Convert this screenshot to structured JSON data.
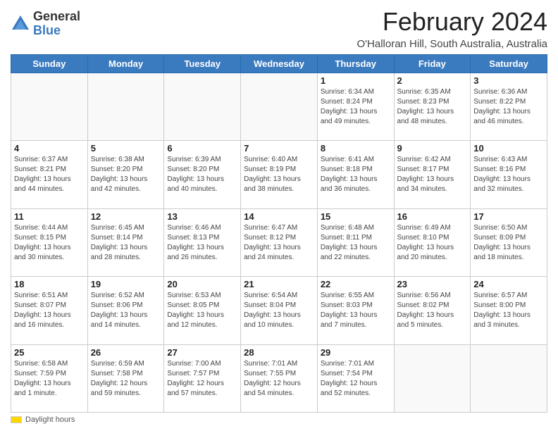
{
  "logo": {
    "general": "General",
    "blue": "Blue"
  },
  "title": "February 2024",
  "location": "O'Halloran Hill, South Australia, Australia",
  "days_header": [
    "Sunday",
    "Monday",
    "Tuesday",
    "Wednesday",
    "Thursday",
    "Friday",
    "Saturday"
  ],
  "weeks": [
    [
      {
        "day": "",
        "info": ""
      },
      {
        "day": "",
        "info": ""
      },
      {
        "day": "",
        "info": ""
      },
      {
        "day": "",
        "info": ""
      },
      {
        "day": "1",
        "info": "Sunrise: 6:34 AM\nSunset: 8:24 PM\nDaylight: 13 hours\nand 49 minutes."
      },
      {
        "day": "2",
        "info": "Sunrise: 6:35 AM\nSunset: 8:23 PM\nDaylight: 13 hours\nand 48 minutes."
      },
      {
        "day": "3",
        "info": "Sunrise: 6:36 AM\nSunset: 8:22 PM\nDaylight: 13 hours\nand 46 minutes."
      }
    ],
    [
      {
        "day": "4",
        "info": "Sunrise: 6:37 AM\nSunset: 8:21 PM\nDaylight: 13 hours\nand 44 minutes."
      },
      {
        "day": "5",
        "info": "Sunrise: 6:38 AM\nSunset: 8:20 PM\nDaylight: 13 hours\nand 42 minutes."
      },
      {
        "day": "6",
        "info": "Sunrise: 6:39 AM\nSunset: 8:20 PM\nDaylight: 13 hours\nand 40 minutes."
      },
      {
        "day": "7",
        "info": "Sunrise: 6:40 AM\nSunset: 8:19 PM\nDaylight: 13 hours\nand 38 minutes."
      },
      {
        "day": "8",
        "info": "Sunrise: 6:41 AM\nSunset: 8:18 PM\nDaylight: 13 hours\nand 36 minutes."
      },
      {
        "day": "9",
        "info": "Sunrise: 6:42 AM\nSunset: 8:17 PM\nDaylight: 13 hours\nand 34 minutes."
      },
      {
        "day": "10",
        "info": "Sunrise: 6:43 AM\nSunset: 8:16 PM\nDaylight: 13 hours\nand 32 minutes."
      }
    ],
    [
      {
        "day": "11",
        "info": "Sunrise: 6:44 AM\nSunset: 8:15 PM\nDaylight: 13 hours\nand 30 minutes."
      },
      {
        "day": "12",
        "info": "Sunrise: 6:45 AM\nSunset: 8:14 PM\nDaylight: 13 hours\nand 28 minutes."
      },
      {
        "day": "13",
        "info": "Sunrise: 6:46 AM\nSunset: 8:13 PM\nDaylight: 13 hours\nand 26 minutes."
      },
      {
        "day": "14",
        "info": "Sunrise: 6:47 AM\nSunset: 8:12 PM\nDaylight: 13 hours\nand 24 minutes."
      },
      {
        "day": "15",
        "info": "Sunrise: 6:48 AM\nSunset: 8:11 PM\nDaylight: 13 hours\nand 22 minutes."
      },
      {
        "day": "16",
        "info": "Sunrise: 6:49 AM\nSunset: 8:10 PM\nDaylight: 13 hours\nand 20 minutes."
      },
      {
        "day": "17",
        "info": "Sunrise: 6:50 AM\nSunset: 8:09 PM\nDaylight: 13 hours\nand 18 minutes."
      }
    ],
    [
      {
        "day": "18",
        "info": "Sunrise: 6:51 AM\nSunset: 8:07 PM\nDaylight: 13 hours\nand 16 minutes."
      },
      {
        "day": "19",
        "info": "Sunrise: 6:52 AM\nSunset: 8:06 PM\nDaylight: 13 hours\nand 14 minutes."
      },
      {
        "day": "20",
        "info": "Sunrise: 6:53 AM\nSunset: 8:05 PM\nDaylight: 13 hours\nand 12 minutes."
      },
      {
        "day": "21",
        "info": "Sunrise: 6:54 AM\nSunset: 8:04 PM\nDaylight: 13 hours\nand 10 minutes."
      },
      {
        "day": "22",
        "info": "Sunrise: 6:55 AM\nSunset: 8:03 PM\nDaylight: 13 hours\nand 7 minutes."
      },
      {
        "day": "23",
        "info": "Sunrise: 6:56 AM\nSunset: 8:02 PM\nDaylight: 13 hours\nand 5 minutes."
      },
      {
        "day": "24",
        "info": "Sunrise: 6:57 AM\nSunset: 8:00 PM\nDaylight: 13 hours\nand 3 minutes."
      }
    ],
    [
      {
        "day": "25",
        "info": "Sunrise: 6:58 AM\nSunset: 7:59 PM\nDaylight: 13 hours\nand 1 minute."
      },
      {
        "day": "26",
        "info": "Sunrise: 6:59 AM\nSunset: 7:58 PM\nDaylight: 12 hours\nand 59 minutes."
      },
      {
        "day": "27",
        "info": "Sunrise: 7:00 AM\nSunset: 7:57 PM\nDaylight: 12 hours\nand 57 minutes."
      },
      {
        "day": "28",
        "info": "Sunrise: 7:01 AM\nSunset: 7:55 PM\nDaylight: 12 hours\nand 54 minutes."
      },
      {
        "day": "29",
        "info": "Sunrise: 7:01 AM\nSunset: 7:54 PM\nDaylight: 12 hours\nand 52 minutes."
      },
      {
        "day": "",
        "info": ""
      },
      {
        "day": "",
        "info": ""
      }
    ]
  ],
  "footer": {
    "legend_label": "Daylight hours"
  }
}
